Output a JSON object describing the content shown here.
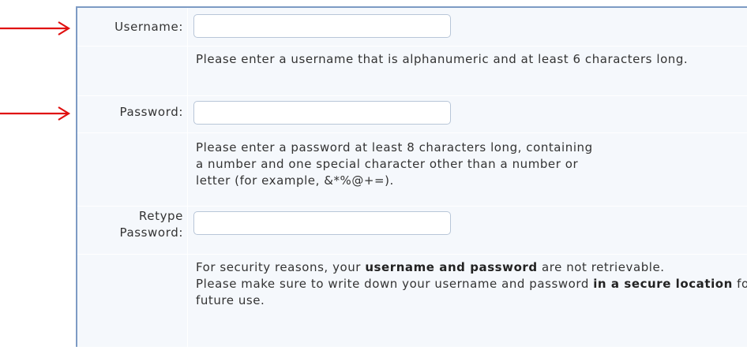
{
  "form": {
    "username": {
      "label": "Username:",
      "value": "",
      "help": "Please enter a username that is alphanumeric and at least 6 characters long."
    },
    "password": {
      "label": "Password:",
      "value": "",
      "help_line1": "Please enter a password at least 8 characters long, containing",
      "help_line2": "a number and one special character other than a number or",
      "help_line3": "letter (for example, &*%@+=)."
    },
    "retype_password": {
      "label_line1": "Retype",
      "label_line2": "Password:",
      "value": ""
    },
    "notice": {
      "part1": "For security reasons, your ",
      "bold1": "username and password",
      "part2": " are not retrievable.",
      "part3": "Please make sure to write down your username and password ",
      "bold2": "in a secure location",
      "part4": " for future use."
    }
  },
  "colors": {
    "arrow": "#e01010",
    "form_border": "#7d9bc4",
    "form_background": "#f5f8fc"
  }
}
